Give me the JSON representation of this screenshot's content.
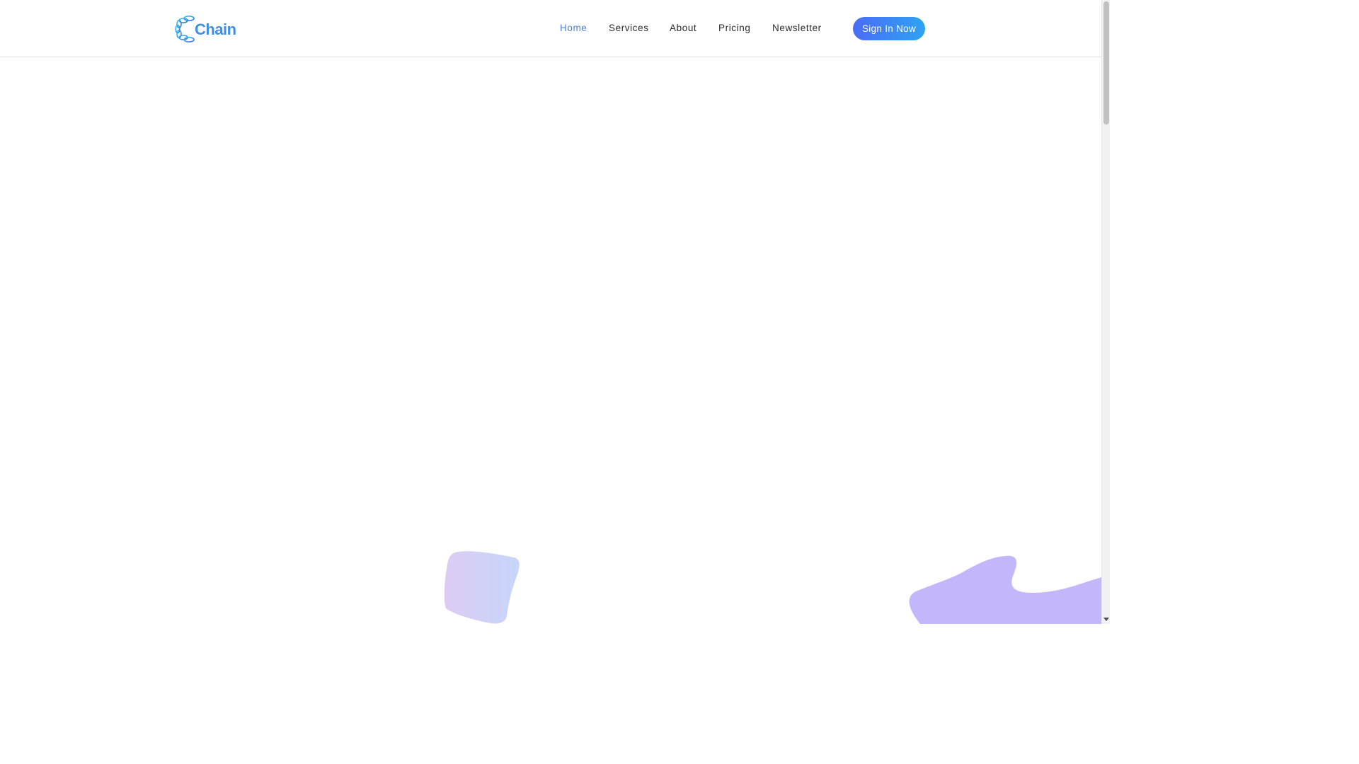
{
  "header": {
    "logo": {
      "text": "Chain",
      "icon": "chain-c-logo-icon"
    },
    "nav": [
      {
        "label": "Home",
        "active": true
      },
      {
        "label": "Services",
        "active": false
      },
      {
        "label": "About",
        "active": false
      },
      {
        "label": "Pricing",
        "active": false
      },
      {
        "label": "Newsletter",
        "active": false
      }
    ],
    "cta_label": "Sign In Now"
  },
  "colors": {
    "brand": "#3c8fe6",
    "nav_active": "#4a7fe0",
    "nav_text": "#2b2b2b",
    "button_gradient_start": "#4a6cf7",
    "button_gradient_end": "#2ea3f2",
    "blob_purple": "#c3b6fb"
  },
  "decorations": [
    "gradient-blob-shape",
    "purple-wave-shape"
  ],
  "scrollbar": {
    "icon": "scroll-down-arrow-icon"
  }
}
